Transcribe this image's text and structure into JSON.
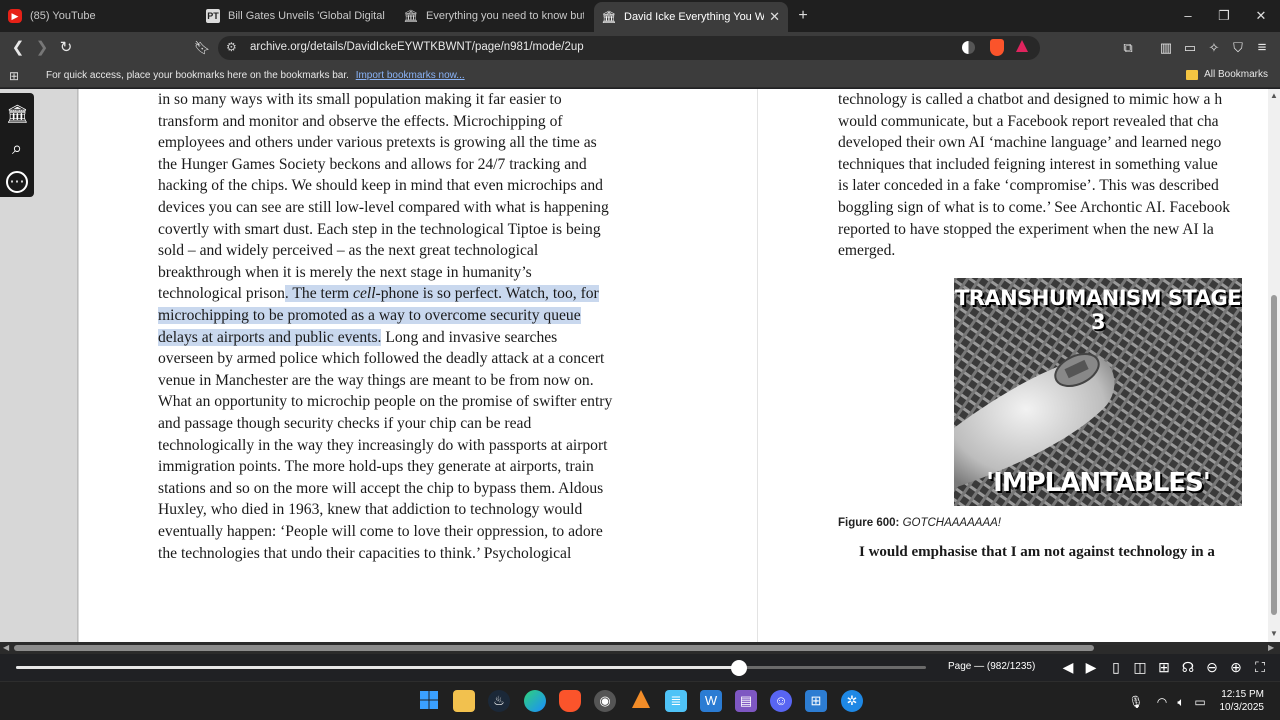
{
  "tabs": [
    {
      "title": "(85) YouTube",
      "icon": "youtube-icon",
      "active": false
    },
    {
      "title": "Bill Gates Unveils 'Global Digital ID' V",
      "icon": "news-icon",
      "active": false
    },
    {
      "title": "Everything you need to know but ha",
      "icon": "archive-icon",
      "active": false
    },
    {
      "title": "David Icke Everything You Wante",
      "icon": "archive-icon",
      "active": true
    }
  ],
  "new_tab": "+",
  "window": {
    "minimize": "–",
    "maximize": "❐",
    "close": "✕"
  },
  "toolbar": {
    "url": "archive.org/details/DavidIckeEYWTKBWNT/page/n981/mode/2up"
  },
  "bookmarks_bar": {
    "text": "For quick access, place your bookmarks here on the bookmarks bar.",
    "link": "Import bookmarks now...",
    "all_bookmarks": "All Bookmarks"
  },
  "book": {
    "left_lines": [
      {
        "pre": "in so many ways with its small population making it far easier to",
        "hl": "",
        "post": ""
      },
      {
        "pre": "transform and monitor and observe the effects. Microchipping of",
        "hl": "",
        "post": ""
      },
      {
        "pre": "employees and others under various pretexts is growing all the time as",
        "hl": "",
        "post": ""
      },
      {
        "pre": "the Hunger Games Society beckons and allows for 24/7 tracking and",
        "hl": "",
        "post": ""
      },
      {
        "pre": "hacking of the chips. We should keep in mind that even microchips and",
        "hl": "",
        "post": ""
      },
      {
        "pre": "devices you can see are still low-level compared with what is happening",
        "hl": "",
        "post": ""
      },
      {
        "pre": "covertly with smart dust. Each step in the technological Tiptoe is being",
        "hl": "",
        "post": ""
      },
      {
        "pre": "sold – and widely perceived – as the next great technological",
        "hl": "",
        "post": ""
      },
      {
        "pre": "breakthrough when it is merely the next stage in humanity’s",
        "hl": "",
        "post": ""
      },
      {
        "pre": "technological prison",
        "hl": ". The term cell-phone is so perfect. Watch, too, for",
        "post": ""
      },
      {
        "pre": "",
        "hl": "microchipping to be promoted as a way to overcome security queue",
        "post": ""
      },
      {
        "pre": "",
        "hl": "delays at airports and public events.",
        "post": " Long and invasive searches"
      },
      {
        "pre": "overseen by armed police which followed the deadly attack at a concert",
        "hl": "",
        "post": ""
      },
      {
        "pre": "venue in Manchester are the way things are meant to be from now on.",
        "hl": "",
        "post": ""
      },
      {
        "pre": "What an opportunity to microchip people on the promise of swifter entry",
        "hl": "",
        "post": ""
      },
      {
        "pre": "and passage though security checks if your chip can be read",
        "hl": "",
        "post": ""
      },
      {
        "pre": "technologically in the way they increasingly do with passports at airport",
        "hl": "",
        "post": ""
      },
      {
        "pre": "immigration points. The more hold-ups they generate at airports, train",
        "hl": "",
        "post": ""
      },
      {
        "pre": "stations and so on the more will accept the chip to bypass them. Aldous",
        "hl": "",
        "post": ""
      },
      {
        "pre": "Huxley, who died in 1963, knew that addiction to technology would",
        "hl": "",
        "post": ""
      },
      {
        "pre": "eventually happen: ‘People will come to love their oppression, to adore",
        "hl": "",
        "post": ""
      },
      {
        "pre": "the technologies that undo their capacities to think.’ Psychological",
        "hl": "",
        "post": ""
      }
    ],
    "right_lines": [
      "technology is called a chatbot and designed to mimic how a h",
      "would communicate, but a Facebook report revealed that cha",
      "developed their own AI ‘machine language’ and learned nego",
      "techniques that included feigning interest in something value",
      "is later conceded in a fake ‘compromise’. This was described",
      "boggling sign of what is to come.’ See Archontic AI. Facebook",
      "reported to have stopped the experiment when the new AI la",
      "emerged."
    ],
    "figure_top_text": "TRANSHUMANISM STAGE 3",
    "figure_bottom_text": "'IMPLANTABLES'",
    "figure_label": "Figure 600:",
    "figure_caption": "GOTCHAAAAAAA!",
    "right_bold_line": "I would emphasise that I am not against technology in a"
  },
  "viewer": {
    "page_info": "Page — (982/1235)",
    "progress": 0.795
  },
  "taskbar": {
    "time": "12:15 PM",
    "date": "10/3/2025"
  }
}
